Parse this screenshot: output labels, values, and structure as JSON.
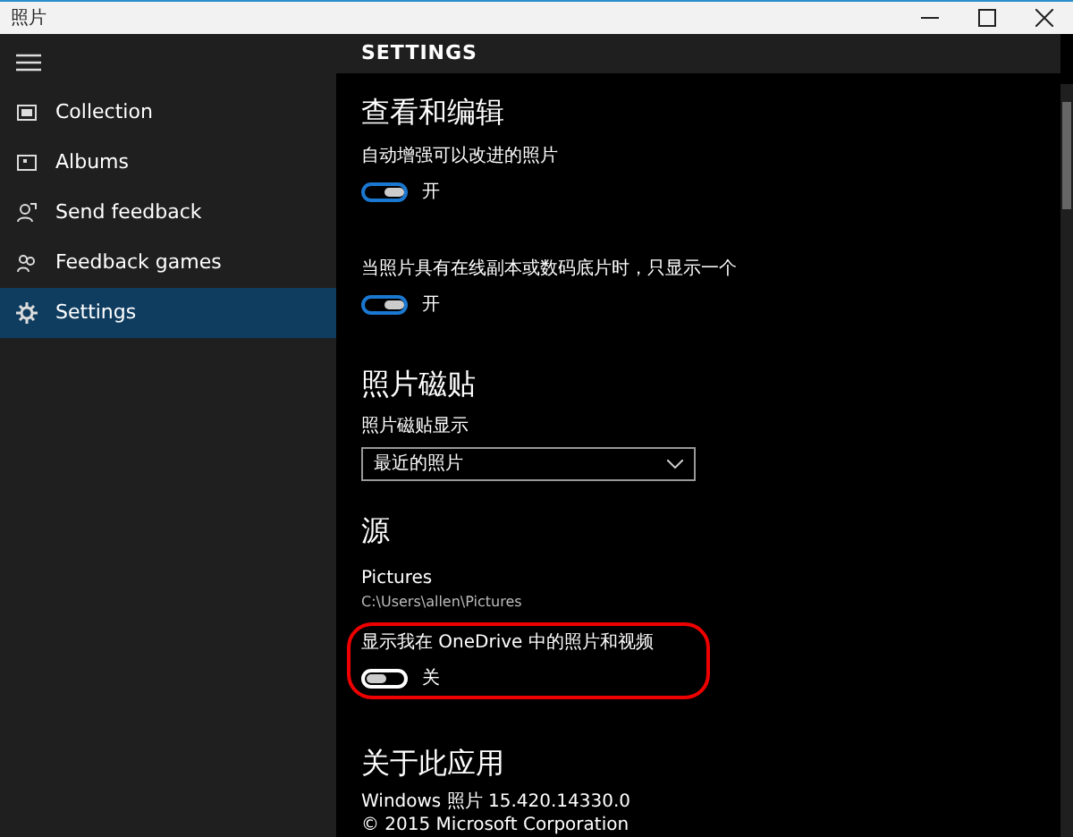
{
  "window": {
    "title": "照片"
  },
  "sidebar": {
    "items": [
      {
        "label": "Collection",
        "selected": false
      },
      {
        "label": "Albums",
        "selected": false
      },
      {
        "label": "Send feedback",
        "selected": false
      },
      {
        "label": "Feedback games",
        "selected": false
      },
      {
        "label": "Settings",
        "selected": true
      }
    ]
  },
  "page_title": "SETTINGS",
  "sections": [
    {
      "heading": "查看和编辑",
      "items": [
        {
          "kind": "toggle",
          "label": "自动增强可以改进的照片",
          "on": true,
          "state_text": "开",
          "highlighted": false
        },
        {
          "kind": "toggle",
          "label": "当照片具有在线副本或数码底片时，只显示一个",
          "on": true,
          "state_text": "开",
          "highlighted": false
        }
      ]
    },
    {
      "heading": "照片磁贴",
      "items": [
        {
          "kind": "dropdown",
          "label": "照片磁贴显示",
          "value": "最近的照片"
        }
      ]
    },
    {
      "heading": "源",
      "items": [
        {
          "kind": "folder",
          "name": "Pictures",
          "path": "C:\\Users\\allen\\Pictures"
        },
        {
          "kind": "toggle",
          "label": "显示我在 OneDrive 中的照片和视频",
          "on": false,
          "state_text": "关",
          "highlighted": true
        }
      ]
    },
    {
      "heading": "关于此应用",
      "items": [
        {
          "kind": "text",
          "lines": [
            "Windows 照片 15.420.14330.0",
            "© 2015 Microsoft Corporation"
          ]
        }
      ]
    }
  ]
}
